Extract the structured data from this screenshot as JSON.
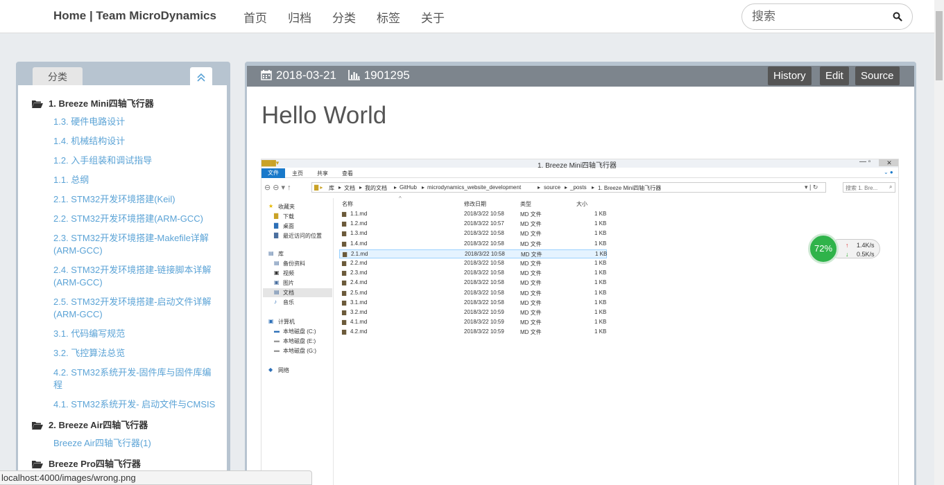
{
  "brand": "Home | Team MicroDynamics",
  "nav": [
    "首页",
    "归档",
    "分类",
    "标签",
    "关于"
  ],
  "search": {
    "placeholder": "搜索"
  },
  "sidebar": {
    "tab_label": "分类",
    "categories": [
      {
        "name": "1. Breeze Mini四轴飞行器",
        "items": [
          "1.3. 硬件电路设计",
          "1.4. 机械结构设计",
          "1.2. 入手组装和调试指导",
          "1.1. 总纲",
          "2.1. STM32开发环境搭建(Keil)",
          "2.2. STM32开发环境搭建(ARM-GCC)",
          "2.3. STM32开发环境搭建-Makefile详解(ARM-GCC)",
          "2.4. STM32开发环境搭建-链接脚本详解(ARM-GCC)",
          "2.5. STM32开发环境搭建-启动文件详解(ARM-GCC)",
          "3.1. 代码编写规范",
          "3.2. 飞控算法总览",
          "4.2. STM32系统开发-固件库与固件库编程",
          "4.1. STM32系统开发- 启动文件与CMSIS"
        ]
      },
      {
        "name": "2. Breeze Air四轴飞行器",
        "items": [
          "Breeze Air四轴飞行器(1)"
        ]
      },
      {
        "name": "Breeze Pro四轴飞行器",
        "items": []
      }
    ]
  },
  "post": {
    "date": "2018-03-21",
    "views": "1901295",
    "buttons": [
      "History",
      "Edit",
      "Source"
    ],
    "title": "Hello World"
  },
  "explorer": {
    "window_title": "1. Breeze Mini四轴飞行器",
    "ribbon_tabs": [
      "文件",
      "主页",
      "共享",
      "查看"
    ],
    "path": [
      "库",
      "文档",
      "我的文档",
      "GitHub",
      "microdynamics_website_development",
      "source",
      "_posts",
      "1. Breeze Mini四轴飞行器"
    ],
    "search_placeholder": "搜索 1. Bre...",
    "nav_tree": [
      "收藏夹",
      "下载",
      "桌面",
      "最近访问的位置",
      "库",
      "备份资料",
      "视频",
      "图片",
      "文档",
      "音乐",
      "计算机",
      "本地磁盘 (C:)",
      "本地磁盘 (E:)",
      "本地磁盘 (G:)",
      "网络"
    ],
    "columns": [
      "名称",
      "修改日期",
      "类型",
      "大小"
    ],
    "files": [
      {
        "name": "1.1.md",
        "date": "2018/3/22 10:58",
        "type": "MD 文件",
        "size": "1 KB"
      },
      {
        "name": "1.2.md",
        "date": "2018/3/22 10:57",
        "type": "MD 文件",
        "size": "1 KB"
      },
      {
        "name": "1.3.md",
        "date": "2018/3/22 10:58",
        "type": "MD 文件",
        "size": "1 KB"
      },
      {
        "name": "1.4.md",
        "date": "2018/3/22 10:58",
        "type": "MD 文件",
        "size": "1 KB"
      },
      {
        "name": "2.1.md",
        "date": "2018/3/22 10:58",
        "type": "MD 文件",
        "size": "1 KB"
      },
      {
        "name": "2.2.md",
        "date": "2018/3/22 10:58",
        "type": "MD 文件",
        "size": "1 KB"
      },
      {
        "name": "2.3.md",
        "date": "2018/3/22 10:58",
        "type": "MD 文件",
        "size": "1 KB"
      },
      {
        "name": "2.4.md",
        "date": "2018/3/22 10:58",
        "type": "MD 文件",
        "size": "1 KB"
      },
      {
        "name": "2.5.md",
        "date": "2018/3/22 10:58",
        "type": "MD 文件",
        "size": "1 KB"
      },
      {
        "name": "3.1.md",
        "date": "2018/3/22 10:58",
        "type": "MD 文件",
        "size": "1 KB"
      },
      {
        "name": "3.2.md",
        "date": "2018/3/22 10:59",
        "type": "MD 文件",
        "size": "1 KB"
      },
      {
        "name": "4.1.md",
        "date": "2018/3/22 10:59",
        "type": "MD 文件",
        "size": "1 KB"
      },
      {
        "name": "4.2.md",
        "date": "2018/3/22 10:59",
        "type": "MD 文件",
        "size": "1 KB"
      }
    ],
    "selected_index": 4,
    "widget": {
      "percent": "72%",
      "up": "1.4K/s",
      "down": "0.5K/s"
    }
  },
  "statusbar": "localhost:4000/images/wrong.png"
}
